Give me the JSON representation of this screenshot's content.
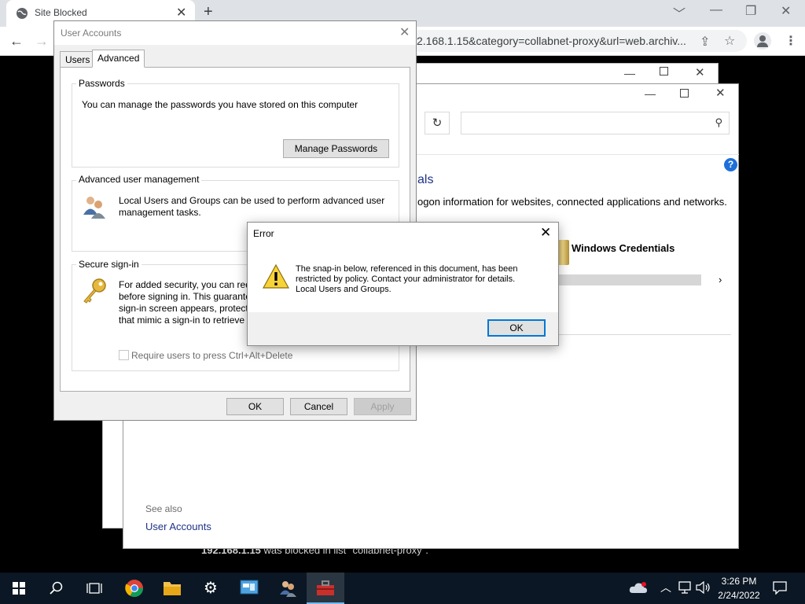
{
  "browser": {
    "tab_title": "Site Blocked",
    "new_tab": "+",
    "tab_close": "✕",
    "url": "2.168.1.15&category=collabnet-proxy&url=web.archiv...",
    "blocked_host": "192.168.1.15",
    "blocked_rest": " was blocked in list \"collabnet-proxy\"."
  },
  "control_panel": {
    "heading_fragment": "als",
    "description_fragment": "ogon information for websites, connected applications and networks.",
    "windows_credentials": "Windows Credentials",
    "see_also": "See also",
    "user_accounts_link": "User Accounts",
    "help": "?"
  },
  "user_accounts": {
    "title": "User Accounts",
    "tabs": [
      "Users",
      "Advanced"
    ],
    "active_tab": "Advanced",
    "passwords": {
      "title": "Passwords",
      "text": "You can manage the passwords you have stored on this computer",
      "button": "Manage Passwords"
    },
    "advanced_mgmt": {
      "title": "Advanced user management",
      "line1": "Local Users and Groups can be used to perform advanced user",
      "line2": "management tasks."
    },
    "secure_signin": {
      "title": "Secure sign-in",
      "line1": "For added security, you can req",
      "line2": "before signing in. This guarante",
      "line3": "sign-in screen appears, protecti",
      "line4": "that mimic a sign-in to retrieve",
      "checkbox_label": "Require users to press Ctrl+Alt+Delete",
      "checkbox_checked": false
    },
    "buttons": {
      "ok": "OK",
      "cancel": "Cancel",
      "apply": "Apply"
    }
  },
  "error_dialog": {
    "title": "Error",
    "line1": "The snap-in below, referenced in this document, has been",
    "line2": "restricted by policy. Contact your administrator for details.",
    "line3": "Local Users and Groups.",
    "ok": "OK"
  },
  "taskbar": {
    "time": "3:26 PM",
    "date": "2/24/2022",
    "accent": "#76b9ed"
  }
}
